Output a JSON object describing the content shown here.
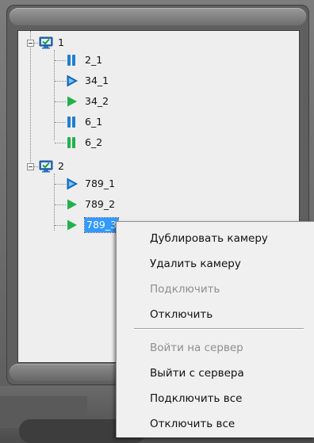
{
  "tree": {
    "groups": [
      {
        "label": "1",
        "cameras": [
          {
            "label": "2_1",
            "state": "paused",
            "color": "#1f7fd1"
          },
          {
            "label": "34_1",
            "state": "play-outline",
            "color": "#1f7fd1"
          },
          {
            "label": "34_2",
            "state": "play",
            "color": "#22b14c"
          },
          {
            "label": "6_1",
            "state": "paused",
            "color": "#1f7fd1"
          },
          {
            "label": "6_2",
            "state": "paused",
            "color": "#22b14c"
          }
        ]
      },
      {
        "label": "2",
        "cameras": [
          {
            "label": "789_1",
            "state": "play-outline",
            "color": "#1f7fd1"
          },
          {
            "label": "789_2",
            "state": "play",
            "color": "#22b14c"
          },
          {
            "label": "789_3",
            "state": "play",
            "color": "#22b14c",
            "selected": true
          }
        ]
      }
    ]
  },
  "context_menu": {
    "items": [
      {
        "label": "Дублировать камеру",
        "enabled": true
      },
      {
        "label": "Удалить камеру",
        "enabled": true
      },
      {
        "label": "Подключить",
        "enabled": false
      },
      {
        "label": "Отключить",
        "enabled": true
      },
      {
        "label": "Войти на сервер",
        "enabled": false
      },
      {
        "label": "Выйти с сервера",
        "enabled": true
      },
      {
        "label": "Подключить все",
        "enabled": true
      },
      {
        "label": "Отключить все",
        "enabled": true
      }
    ]
  },
  "colors": {
    "play_blue": "#1f7fd1",
    "play_green": "#22b14c",
    "selection": "#3399ff"
  }
}
